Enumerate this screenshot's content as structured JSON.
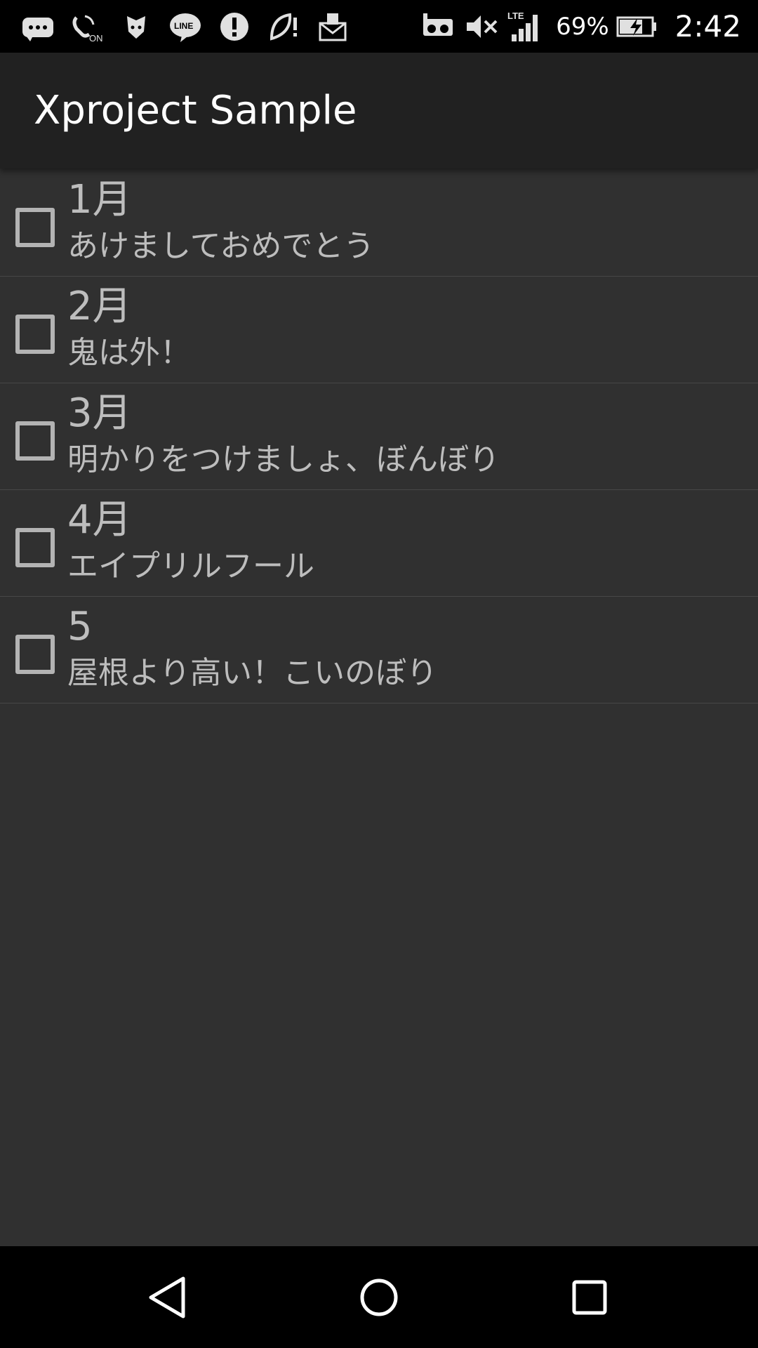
{
  "status_bar": {
    "left_icons": [
      "message-icon",
      "wifi-calling-on-icon",
      "shield-app-icon",
      "line-app-icon",
      "alert-icon",
      "leaf-alert-icon",
      "mail-app-icon"
    ],
    "right_icons": [
      "voicemail-icon",
      "mute-icon",
      "lte-signal-icon",
      "battery-charging-icon"
    ],
    "battery_percent": "69%",
    "time": "2:42"
  },
  "app_bar": {
    "title": "Xproject Sample"
  },
  "list": {
    "items": [
      {
        "title": "1月",
        "description": "あけましておめでとう",
        "checked": false
      },
      {
        "title": "2月",
        "description": "鬼は外！",
        "checked": false
      },
      {
        "title": "3月",
        "description": "明かりをつけましょ、ぼんぼり",
        "checked": false
      },
      {
        "title": "4月",
        "description": "エイプリルフール",
        "checked": false
      },
      {
        "title": "5",
        "description": "屋根より高い！こいのぼり",
        "checked": false
      }
    ]
  },
  "nav_bar": {
    "buttons": [
      "back-icon",
      "home-icon",
      "recents-icon"
    ]
  },
  "colors": {
    "background": "#303030",
    "app_bar": "#212121",
    "text": "#bdbdbd",
    "divider": "#474747"
  }
}
